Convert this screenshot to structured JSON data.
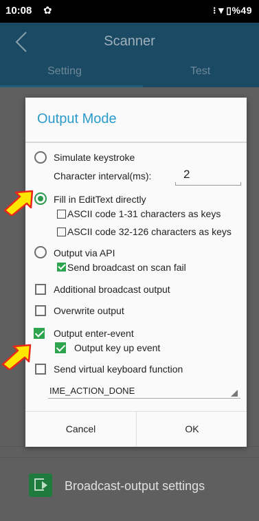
{
  "status_bar": {
    "time": "10:08",
    "settings_icon": "gear-icon",
    "right_text": "⁝▼▯%49"
  },
  "app_bar": {
    "title": "Scanner",
    "back_icon": "chevron-left-icon"
  },
  "tabs": [
    {
      "label": "Setting",
      "selected": true
    },
    {
      "label": "Test",
      "selected": false
    }
  ],
  "background_rows": [
    {
      "label": "Broadcast-output settings",
      "icon": "broadcast-output-icon"
    }
  ],
  "dialog": {
    "title": "Output Mode",
    "options": {
      "simulate_keystroke": "Simulate keystroke",
      "character_interval_label": "Character interval(ms):",
      "character_interval_value": "2",
      "fill_edittext": "Fill in EditText directly",
      "ascii_1_31": "ASCII code 1-31 characters as keys",
      "ascii_32_126": "ASCII code 32-126 characters as keys",
      "output_via_api": "Output via API",
      "send_broadcast_fail": "Send broadcast on scan fail",
      "additional_broadcast": "Additional broadcast output",
      "overwrite_output": "Overwrite output",
      "output_enter_event": "Output enter-event",
      "output_key_up": "Output key up event",
      "send_virtual_keyboard": "Send virtual keyboard function"
    },
    "ime_action": "IME_ACTION_DONE",
    "cancel_label": "Cancel",
    "ok_label": "OK"
  },
  "colors": {
    "accent": "#2a9ac9",
    "checked_green": "#2fa44f",
    "app_bar": "#1b4a64",
    "pointer_yellow": "#ffe600",
    "pointer_outline": "#e8261b"
  }
}
